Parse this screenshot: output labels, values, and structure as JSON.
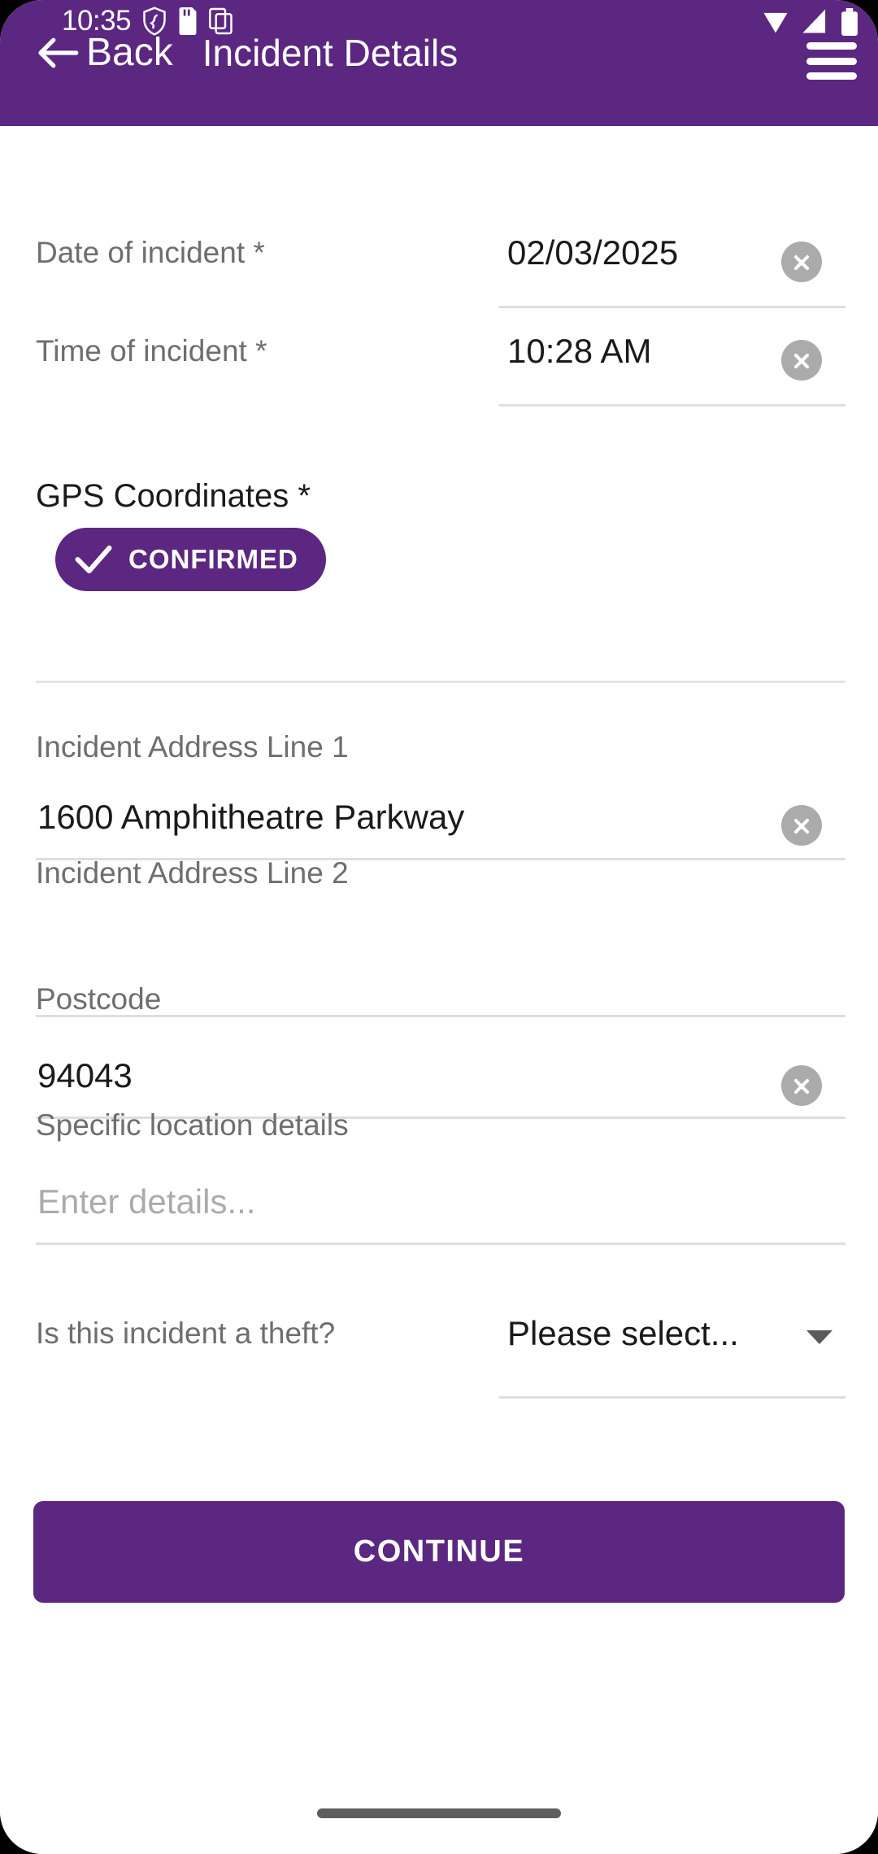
{
  "status_bar": {
    "clock": "10:35",
    "icons_left": [
      "shield-icon",
      "sd-card-icon",
      "screenshot-icon"
    ],
    "icons_right": [
      "wifi-icon",
      "cellular-signal-icon",
      "battery-icon"
    ]
  },
  "app_bar": {
    "back_label": "Back",
    "title": "Incident Details",
    "menu_icon": "hamburger-menu-icon",
    "background_color": "#5B2781"
  },
  "form": {
    "date": {
      "label": "Date of incident *",
      "value": "02/03/2025"
    },
    "time": {
      "label": "Time of incident *",
      "value": "10:28 AM"
    },
    "gps": {
      "label": "GPS Coordinates *",
      "button_label": "CONFIRMED",
      "button_icon": "check-icon"
    },
    "address_line_1": {
      "label": "Incident Address Line 1",
      "value": "1600 Amphitheatre Parkway"
    },
    "address_line_2": {
      "label": "Incident Address Line 2",
      "value": ""
    },
    "postcode": {
      "label": "Postcode",
      "value": "94043"
    },
    "location_details": {
      "label": "Specific location details",
      "value": "",
      "placeholder": "Enter details..."
    },
    "theft": {
      "label": "Is this incident a theft?",
      "value": "Please select...",
      "options": [
        "Please select..."
      ]
    }
  },
  "footer": {
    "continue_label": "CONTINUE"
  }
}
